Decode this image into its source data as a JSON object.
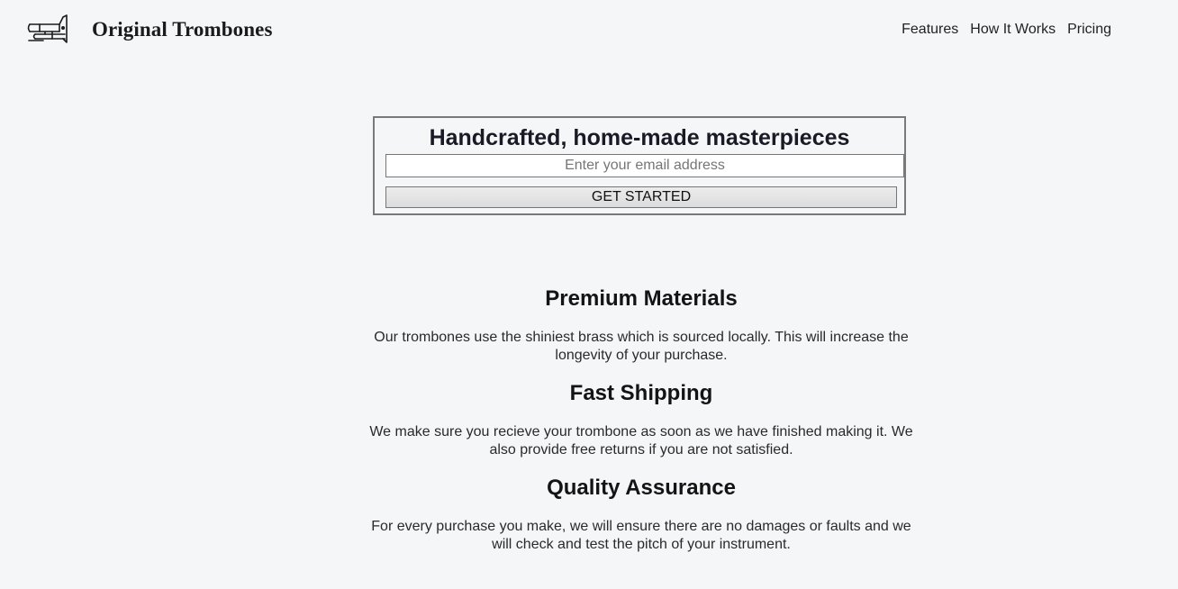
{
  "header": {
    "brand_name": "Original Trombones",
    "logo_icon": "trombone-icon",
    "nav": [
      {
        "label": "Features"
      },
      {
        "label": "How It Works"
      },
      {
        "label": "Pricing"
      }
    ]
  },
  "hero": {
    "title": "Handcrafted, home-made masterpieces",
    "email_placeholder": "Enter your email address",
    "email_value": "",
    "cta_label": "GET STARTED"
  },
  "features": [
    {
      "title": "Premium Materials",
      "description": "Our trombones use the shiniest brass which is sourced locally. This will increase the longevity of your purchase."
    },
    {
      "title": "Fast Shipping",
      "description": "We make sure you recieve your trombone as soon as we have finished making it. We also provide free returns if you are not satisfied."
    },
    {
      "title": "Quality Assurance",
      "description": "For every purchase you make, we will ensure there are no damages or faults and we will check and test the pitch of your instrument."
    }
  ],
  "colors": {
    "background": "#f5f6f8",
    "text": "#1f1f1f",
    "border": "#7a7a7a"
  }
}
